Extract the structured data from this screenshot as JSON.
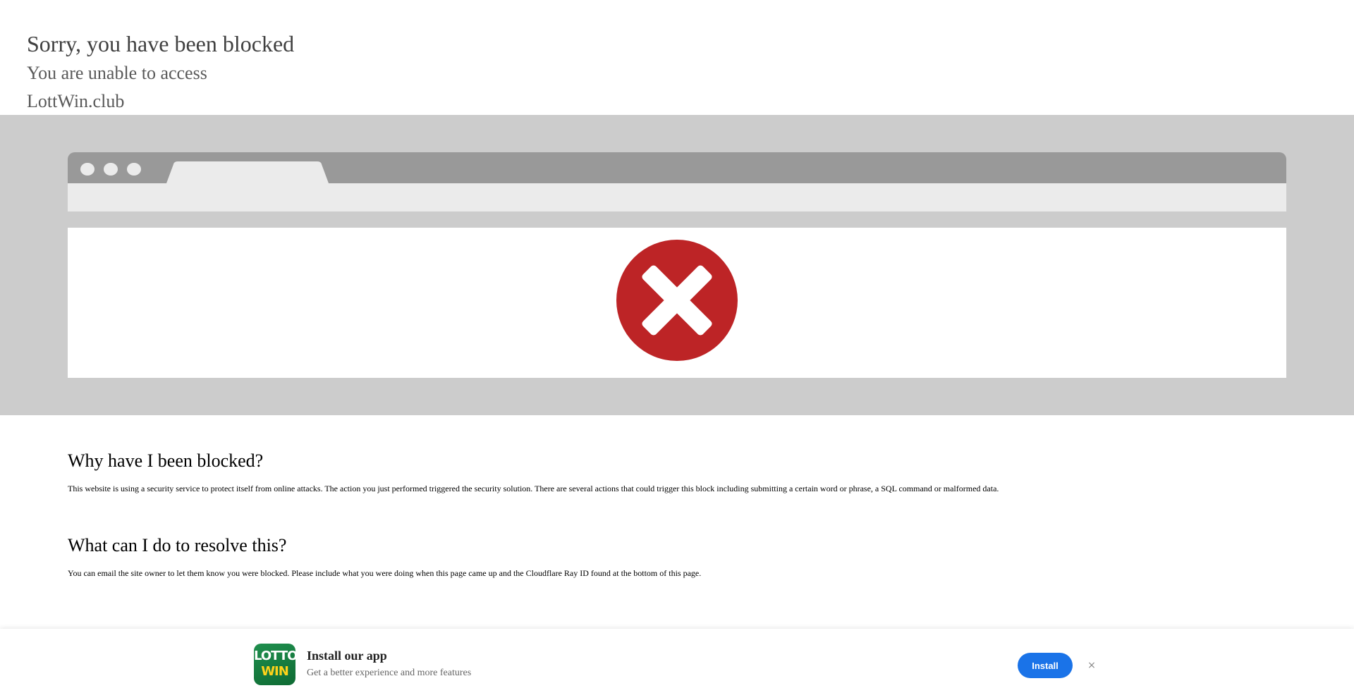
{
  "header": {
    "title": "Sorry, you have been blocked",
    "subtitle_line1": "You are unable to access",
    "subtitle_line2": "LottWin.club"
  },
  "illustration": {
    "icon": "error-x-icon",
    "icon_color": "#bd2426",
    "band_color": "#cccccc",
    "chrome_color": "#999999"
  },
  "sections": [
    {
      "heading": "Why have I been blocked?",
      "body": "This website is using a security service to protect itself from online attacks. The action you just performed triggered the security solution. There are several actions that could trigger this block including submitting a certain word or phrase, a SQL command or malformed data."
    },
    {
      "heading": "What can I do to resolve this?",
      "body": "You can email the site owner to let them know you were blocked. Please include what you were doing when this page came up and the Cloudflare Ray ID found at the bottom of this page."
    }
  ],
  "install_banner": {
    "logo_line1": "LOTTO",
    "logo_line2": "WIN",
    "title": "Install our app",
    "description": "Get a better experience and more features",
    "install_label": "Install",
    "close_label": "×",
    "accent_color": "#1a73e8"
  }
}
